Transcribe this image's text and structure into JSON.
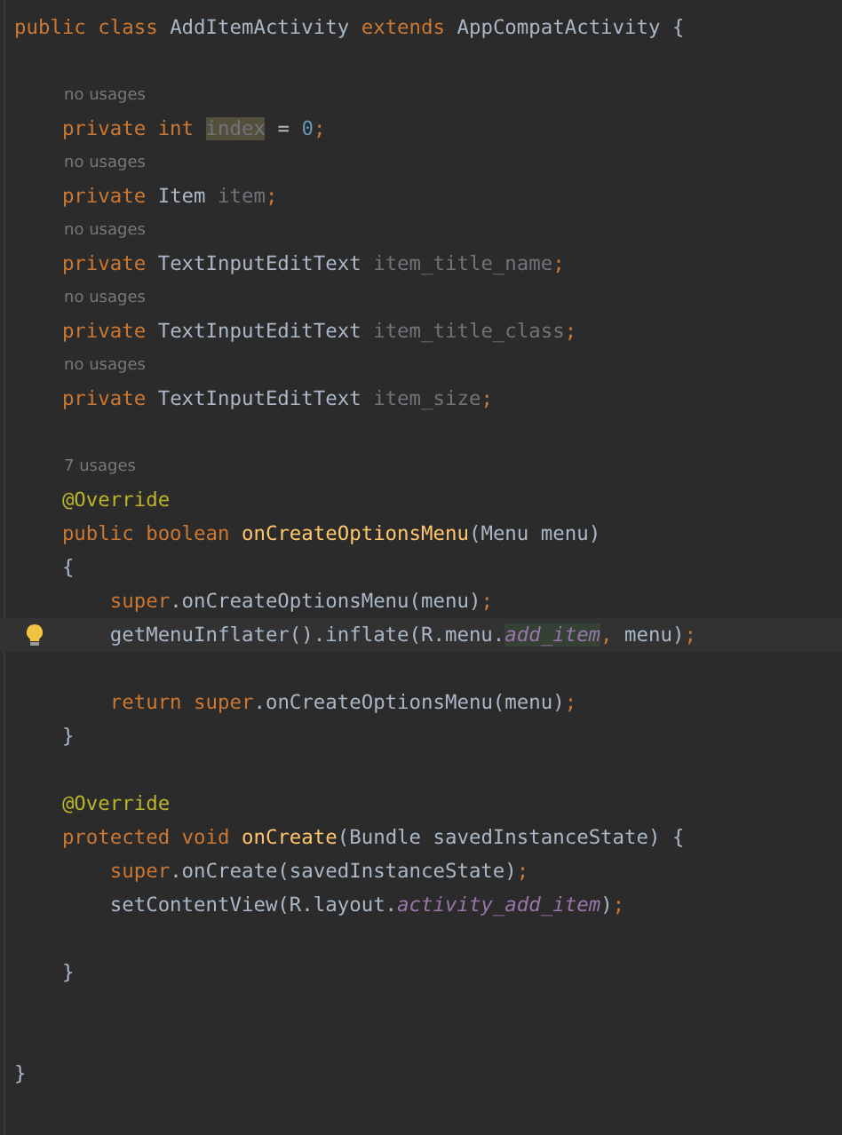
{
  "editor": {
    "lines": [
      {
        "kind": "code",
        "current": false,
        "tokens": [
          {
            "t": "public class ",
            "kind": "keyword"
          },
          {
            "t": "AddItemActivity ",
            "kind": "plain"
          },
          {
            "t": "extends ",
            "kind": "keyword"
          },
          {
            "t": "AppCompatActivity {",
            "kind": "plain"
          }
        ]
      },
      {
        "kind": "blank"
      },
      {
        "kind": "hint",
        "text": "no usages"
      },
      {
        "kind": "code",
        "current": false,
        "tokens": [
          {
            "t": "    private int ",
            "kind": "keyword"
          },
          {
            "t": "index",
            "kind": "match"
          },
          {
            "t": " = ",
            "kind": "plain"
          },
          {
            "t": "0",
            "kind": "number"
          },
          {
            "t": ";",
            "kind": "keyword"
          }
        ]
      },
      {
        "kind": "hint",
        "text": "no usages"
      },
      {
        "kind": "code",
        "current": false,
        "tokens": [
          {
            "t": "    private ",
            "kind": "keyword"
          },
          {
            "t": "Item ",
            "kind": "plain"
          },
          {
            "t": "item",
            "kind": "unused"
          },
          {
            "t": ";",
            "kind": "keyword"
          }
        ]
      },
      {
        "kind": "hint",
        "text": "no usages"
      },
      {
        "kind": "code",
        "current": false,
        "tokens": [
          {
            "t": "    private ",
            "kind": "keyword"
          },
          {
            "t": "TextInputEditText ",
            "kind": "plain"
          },
          {
            "t": "item_title_name",
            "kind": "unused"
          },
          {
            "t": ";",
            "kind": "keyword"
          }
        ]
      },
      {
        "kind": "hint",
        "text": "no usages"
      },
      {
        "kind": "code",
        "current": false,
        "tokens": [
          {
            "t": "    private ",
            "kind": "keyword"
          },
          {
            "t": "TextInputEditText ",
            "kind": "plain"
          },
          {
            "t": "item_title_class",
            "kind": "unused"
          },
          {
            "t": ";",
            "kind": "keyword"
          }
        ]
      },
      {
        "kind": "hint",
        "text": "no usages"
      },
      {
        "kind": "code",
        "current": false,
        "tokens": [
          {
            "t": "    private ",
            "kind": "keyword"
          },
          {
            "t": "TextInputEditText ",
            "kind": "plain"
          },
          {
            "t": "item_size",
            "kind": "unused"
          },
          {
            "t": ";",
            "kind": "keyword"
          }
        ]
      },
      {
        "kind": "blank"
      },
      {
        "kind": "hint",
        "text": "7 usages"
      },
      {
        "kind": "code",
        "current": false,
        "tokens": [
          {
            "t": "    @Override",
            "kind": "annotation"
          }
        ]
      },
      {
        "kind": "code",
        "current": false,
        "tokens": [
          {
            "t": "    public boolean ",
            "kind": "keyword"
          },
          {
            "t": "onCreateOptionsMenu",
            "kind": "method"
          },
          {
            "t": "(Menu menu)",
            "kind": "plain"
          }
        ]
      },
      {
        "kind": "code",
        "current": false,
        "tokens": [
          {
            "t": "    {",
            "kind": "plain"
          }
        ]
      },
      {
        "kind": "code",
        "current": false,
        "tokens": [
          {
            "t": "        super",
            "kind": "keyword"
          },
          {
            "t": ".onCreateOptionsMenu(menu)",
            "kind": "plain"
          },
          {
            "t": ";",
            "kind": "keyword"
          }
        ]
      },
      {
        "kind": "code",
        "current": true,
        "tokens": [
          {
            "t": "        getMenuInflater().inflate(R.menu.",
            "kind": "plain"
          },
          {
            "t": "add_item",
            "kind": "static-match"
          },
          {
            "t": ", ",
            "kind": "keyword"
          },
          {
            "t": "menu)",
            "kind": "plain"
          },
          {
            "t": ";",
            "kind": "keyword"
          }
        ]
      },
      {
        "kind": "blank"
      },
      {
        "kind": "code",
        "current": false,
        "tokens": [
          {
            "t": "        return super",
            "kind": "keyword"
          },
          {
            "t": ".onCreateOptionsMenu(menu)",
            "kind": "plain"
          },
          {
            "t": ";",
            "kind": "keyword"
          }
        ]
      },
      {
        "kind": "code",
        "current": false,
        "tokens": [
          {
            "t": "    }",
            "kind": "plain"
          }
        ]
      },
      {
        "kind": "blank"
      },
      {
        "kind": "code",
        "current": false,
        "tokens": [
          {
            "t": "    @Override",
            "kind": "annotation"
          }
        ]
      },
      {
        "kind": "code",
        "current": false,
        "tokens": [
          {
            "t": "    protected void ",
            "kind": "keyword"
          },
          {
            "t": "onCreate",
            "kind": "method"
          },
          {
            "t": "(Bundle savedInstanceState) {",
            "kind": "plain"
          }
        ]
      },
      {
        "kind": "code",
        "current": false,
        "tokens": [
          {
            "t": "        super",
            "kind": "keyword"
          },
          {
            "t": ".onCreate(savedInstanceState)",
            "kind": "plain"
          },
          {
            "t": ";",
            "kind": "keyword"
          }
        ]
      },
      {
        "kind": "code",
        "current": false,
        "tokens": [
          {
            "t": "        setContentView(R.layout.",
            "kind": "plain"
          },
          {
            "t": "activity_add_item",
            "kind": "static"
          },
          {
            "t": ")",
            "kind": "plain"
          },
          {
            "t": ";",
            "kind": "keyword"
          }
        ]
      },
      {
        "kind": "blank"
      },
      {
        "kind": "code",
        "current": false,
        "tokens": [
          {
            "t": "    }",
            "kind": "plain"
          }
        ]
      },
      {
        "kind": "blank"
      },
      {
        "kind": "blank"
      },
      {
        "kind": "code",
        "current": false,
        "tokens": [
          {
            "t": "}",
            "kind": "plain"
          }
        ]
      }
    ]
  }
}
